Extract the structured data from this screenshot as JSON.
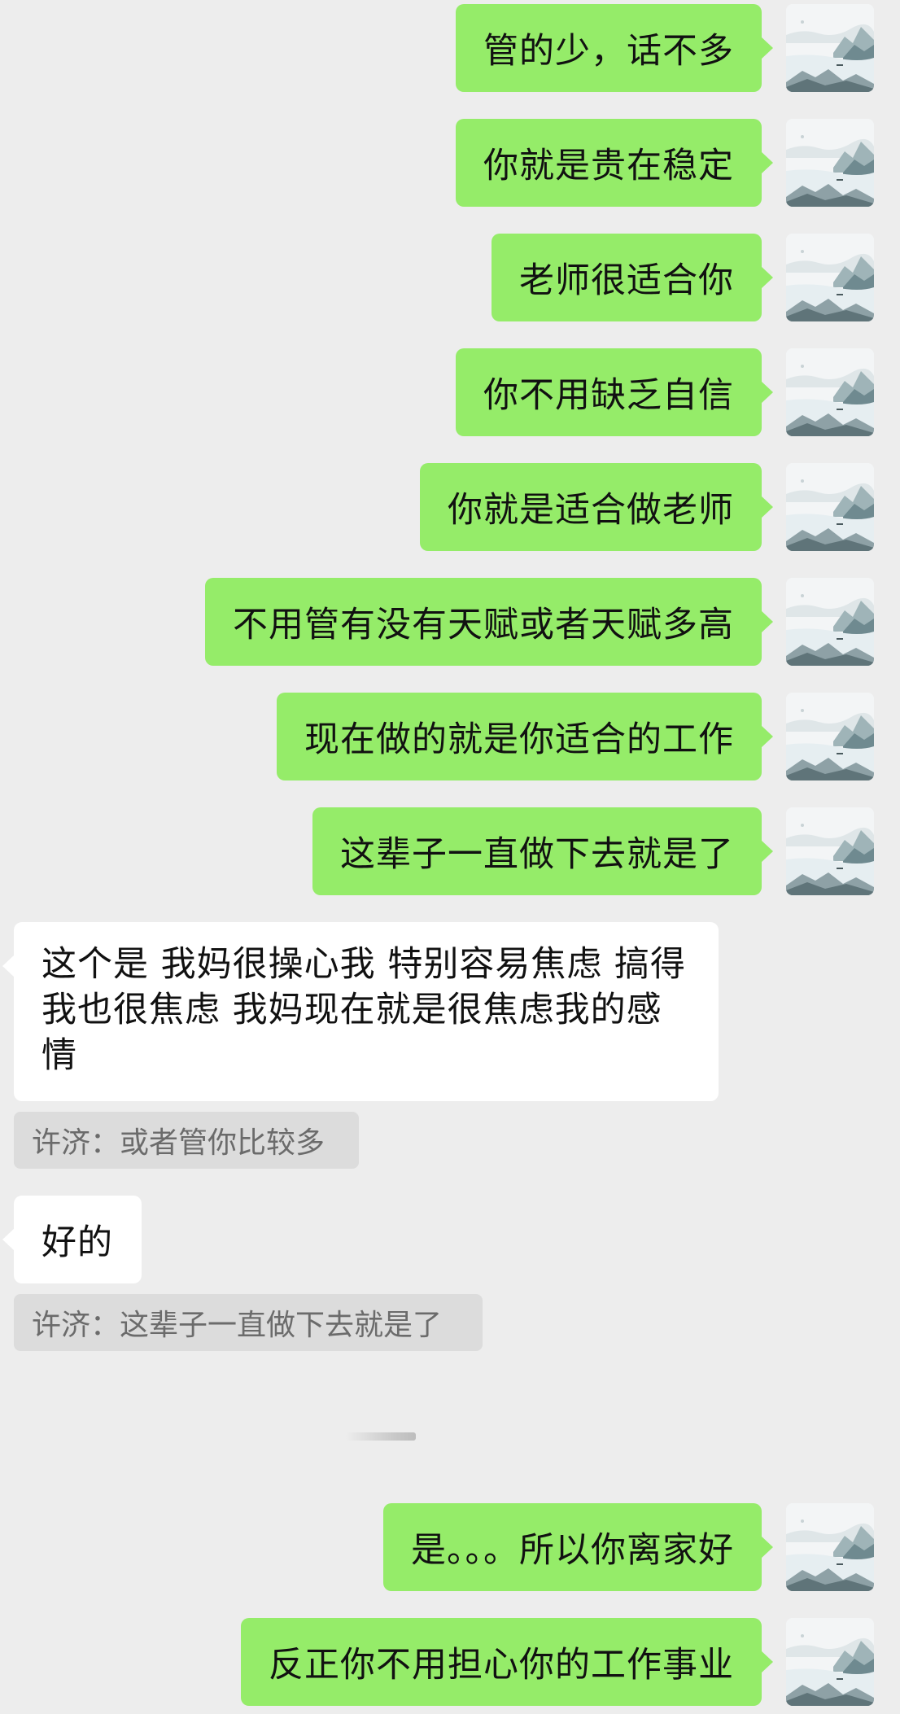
{
  "chat": {
    "messages_top": [
      {
        "text": "管的少，话不多"
      },
      {
        "text": "你就是贵在稳定"
      },
      {
        "text": "老师很适合你"
      },
      {
        "text": "你不用缺乏自信"
      },
      {
        "text": "你就是适合做老师"
      },
      {
        "text": "不用管有没有天赋或者天赋多高"
      },
      {
        "text": "现在做的就是你适合的工作"
      },
      {
        "text": "这辈子一直做下去就是了"
      }
    ],
    "reply_1": {
      "line1": "这个是 我妈很操心我 特别容易焦虑 搞得",
      "line2": "我也很焦虑 我妈现在就是很焦虑我的感",
      "line3": "情"
    },
    "quote_1": "许济：或者管你比较多",
    "reply_2": "好的",
    "quote_2": "许济：这辈子一直做下去就是了",
    "messages_bottom": [
      {
        "text": "是。。。所以你离家好"
      },
      {
        "text": "反正你不用担心你的工作事业"
      }
    ]
  },
  "colors": {
    "background": "#ededed",
    "sent_bubble": "#95ec69",
    "received_bubble": "#ffffff",
    "quote_background": "#dcdcdc"
  },
  "icons": {
    "avatar": "landscape-painting-avatar-icon"
  }
}
